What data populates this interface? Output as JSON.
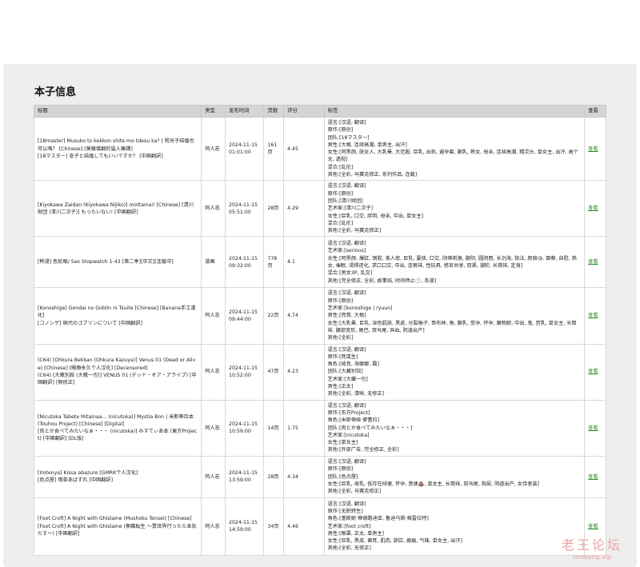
{
  "page": {
    "title": "本子信息",
    "columns": [
      "标题",
      "类型",
      "发布时间",
      "页数",
      "评分",
      "标签",
      "查看"
    ]
  },
  "rows": [
    {
      "title": [
        "[18master] Musuko to kekkon shite mo tdesu ka? | 和兒子結婚也可以嗎？ [Chinese] [莫藤傑翻的猛人雞譯]",
        "[18マスター] 息子と結婚してもいいですか？ [中国翻訳]"
      ],
      "type": "同人志",
      "date": "2024-11-15",
      "time": "01:01:00",
      "pages": "161页",
      "rating": "4.45",
      "tags": [
        "语言:[汉语, 翻译]",
        "原作:[原创]",
        "团队:[18マスター]",
        "男性:[大根, 连续高潮, 单男主, 出汗]",
        "女性:[阿黑颜, 肤女人, 大乳晕, 大范股, 巨乳, 出轨, 避孕套, 腋乳, 熟女, 母亲, 连续高潮, 精灵头, 单女主, 出汗, 高个女, 透视]",
        "混合:[乱伦]",
        "其他:[全彩, 马赛克修正, 系列作品, 连载]"
      ],
      "view": "查看"
    },
    {
      "title": [
        "[Kiyokawa Zaidan (Kiyokawa Nijiko)] mottainai! [Chinese] [清川財団 (清川二次子)] もったいない! [中国翻訳]"
      ],
      "type": "同人志",
      "date": "2024-11-15",
      "time": "05:51:00",
      "pages": "28页",
      "rating": "4.29",
      "tags": [
        "语言:[汉语, 翻译]",
        "原作:[原创]",
        "团队:[清川财团]",
        "艺术家:[清川二次子]",
        "女性:[巨乳, 口交, 胖阴, 母亲, 中出, 单女主]",
        "混合:[乱伦]",
        "其他:[全彩, 马赛克修正]"
      ],
      "view": "查看"
    },
    {
      "title": [
        "[韩漫] 色轮眼/ Sex Stopwatch 1-43 [第二季][中文][连载中]"
      ],
      "type": "漫画",
      "date": "2024-11-15",
      "time": "09:32:00",
      "pages": "778页",
      "rating": "4.1",
      "tags": [
        "语言:[汉语, 翻译]",
        "艺术家:[serious]",
        "女性:[阿黑颜, 爆肛, 钢胶, 美人痣, 巨乳, 要挟, 口交, 阴蒂刺激, 腋阴, 圆阴唇, 长刘海, 指法, 颜骑😘, 面尊, 自慰, 熟女, 催眠, 渴得进化, 求口口交, 中出, 连裤袜, 性玩具, 感官共享, 双渠, 潮吹, 长筒袜, 定身]",
        "混合:[男女3P, 乱交]",
        "其他:[完全修正, 全彩, 故事线, 时间停止🕐, 条漫]"
      ],
      "view": "查看"
    },
    {
      "title": [
        "[Konoshige] Gendai no Goblin ni Tsuite [Chinese] [Banana手工漢化]",
        "[コノシゲ] 現代のゴブリンについて [中国翻訳]"
      ],
      "type": "同人志",
      "date": "2024-11-15",
      "time": "09:44:00",
      "pages": "22页",
      "rating": "4.74",
      "tags": [
        "语言:[汉语, 翻译]",
        "原作:[原创]",
        "艺术家:[konoshige | ryuun]",
        "男性:[兜首, 大根]",
        "女性:[大乳晕, 巨乳, 深色肌肤, 黑皮, 分裂柚子, 哥布林, 角, 腋乳, 受孕, 怀孕, 魔物娘, 中出, 鬼, 宫乳, 单女主, 长筒袜, 腰部变形, 尾巴, 双马尾, 异血, 阴道出产]",
        "其他:[全彩]"
      ],
      "view": "查看"
    },
    {
      "title": [
        "(C64) [Ohkura Bekkan (Ohkura Kazuya)] Venus 01 (Dead or Alive) [Chinese] [暱療永久个人汉化] [Decensored]",
        "(C64) [大蔵別館 (大蔵一也)] VENUS 01 (デッド・オア・アライブ) [中国翻訳] [無修正]"
      ],
      "type": "同人志",
      "date": "2024-11-15",
      "time": "10:52:00",
      "pages": "47页",
      "rating": "4.23",
      "tags": [
        "语言:[汉语, 翻译]",
        "原作:[死或生]",
        "角色:[绫音, 海娜娜, 霞]",
        "团队:[大藏别馆]",
        "艺术家:[大藏一也]",
        "男性:[正太]",
        "其他:[全彩, 清晰, 无修正]"
      ],
      "view": "查看"
    },
    {
      "title": [
        "[Nicutoka Tabete Mitainaa... (nicutoka)] Mystia Bon | 米斯蒂亞本 (Touhou Project) [Chinese] [Digital]",
        "[肉とか食べてみたいなぁ・・・ (nicutoka)] みすてぃあ本 (東方Project) [中国翻訳] [DL版]"
      ],
      "type": "同人志",
      "date": "2024-11-15",
      "time": "10:59:00",
      "pages": "14页",
      "rating": "1.75",
      "tags": [
        "语言:[汉语, 翻译]",
        "原作:[东方Project]",
        "角色:[米斯蒂娅·萝蕾拉]",
        "团队:[肉とか食べてみたいなぁ・・・]",
        "艺术家:[nicutoka]",
        "女性:[单女主]",
        "其他:[外部广告, 完全修正, 全彩]"
      ],
      "view": "查看"
    },
    {
      "title": [
        "[Irotenya] Kissa abazure [GMRK个人汉化]",
        "[色点屋] 喫茶あばずれ [中国翻訳]"
      ],
      "type": "同人志",
      "date": "2024-11-15",
      "time": "13:59:00",
      "pages": "28页",
      "rating": "4.34",
      "tags": [
        "语言:[汉语, 翻译]",
        "原作:[原创]",
        "团队:[色点屋]",
        "女性:[巨乳, 母乳, 低存在排便, 怀孕, 粪便💩, 单女主, 长筒袜, 双马尾, 指尿, 阴道出产, 女侍者装]",
        "其他:[全彩, 马赛克修正]"
      ],
      "view": "查看"
    },
    {
      "title": [
        "[Foot Croft] A Night with Ghislaine (Mushoku Tensei) [Chinese]",
        "[Foot Croft] A Night with Ghislaine (無職転生 ～異世界行ったら本気だす～) [中国翻訳]"
      ],
      "type": "同人志",
      "date": "2024-11-15",
      "time": "14:59:00",
      "pages": "34页",
      "rating": "4.46",
      "tags": [
        "语言:[汉语, 翻译]",
        "原作:[无职转生]",
        "角色:[基斯妮·蒂德路迪亚, 鲁迪乌斯·格雷拉特]",
        "艺术家:[foot croft]",
        "男性:[眼罩, 正太, 单男主]",
        "女性:[巨乳, 黑皮, 兽耳, 肌肉, 舔肛, 瘢痕, 气味, 单女主, 出汗]",
        "其他:[全彩, 无修正]"
      ],
      "view": "查看"
    }
  ],
  "watermark": {
    "cn": "老王论坛",
    "en": "laowang.vip"
  }
}
